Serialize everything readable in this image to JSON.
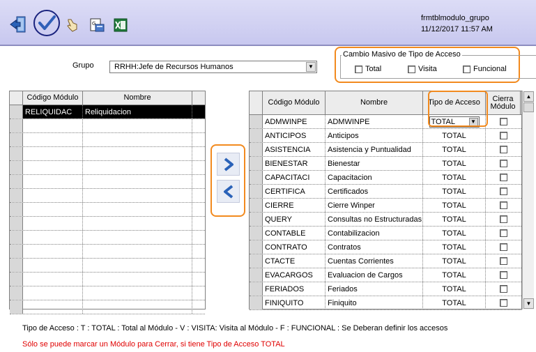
{
  "toolbar": {
    "window_name": "frmtblmodulo_grupo",
    "datetime": "11/12/2017 11:57 AM",
    "icons": [
      "exit-icon",
      "confirm-check-icon",
      "hand-pointer-icon",
      "report-icon",
      "excel-icon"
    ]
  },
  "grupo": {
    "label": "Grupo",
    "value": "RRHH:Jefe de Recursos Humanos"
  },
  "cambio_masivo": {
    "legend": "Cambio Masivo de Tipo de Acceso",
    "options": [
      "Total",
      "Visita",
      "Funcional"
    ]
  },
  "left_grid": {
    "headers": [
      "Código Módulo",
      "Nombre"
    ],
    "rows": [
      {
        "codigo": "RELIQUIDAC",
        "nombre": "Reliquidacion",
        "selected": true
      }
    ],
    "total_rows": 15
  },
  "right_grid": {
    "headers": [
      "Código Módulo",
      "Nombre",
      "Tipo de Acceso",
      "Cierra Módulo"
    ],
    "rows": [
      {
        "codigo": "ADMWINPE",
        "nombre": "ADMWINPE",
        "tipo": "TOTAL",
        "editing": true
      },
      {
        "codigo": "ANTICIPOS",
        "nombre": "Anticipos",
        "tipo": "TOTAL"
      },
      {
        "codigo": "ASISTENCIA",
        "nombre": "Asistencia y Puntualidad",
        "tipo": "TOTAL"
      },
      {
        "codigo": "BIENESTAR",
        "nombre": "Bienestar",
        "tipo": "TOTAL"
      },
      {
        "codigo": "CAPACITACI",
        "nombre": "Capacitacion",
        "tipo": "TOTAL"
      },
      {
        "codigo": "CERTIFICA",
        "nombre": "Certificados",
        "tipo": "TOTAL"
      },
      {
        "codigo": "CIERRE",
        "nombre": "Cierre Winper",
        "tipo": "TOTAL"
      },
      {
        "codigo": "QUERY",
        "nombre": "Consultas no Estructuradas",
        "tipo": "TOTAL"
      },
      {
        "codigo": "CONTABLE",
        "nombre": "Contabilizacion",
        "tipo": "TOTAL"
      },
      {
        "codigo": "CONTRATO",
        "nombre": "Contratos",
        "tipo": "TOTAL"
      },
      {
        "codigo": "CTACTE",
        "nombre": "Cuentas Corrientes",
        "tipo": "TOTAL"
      },
      {
        "codigo": "EVACARGOS",
        "nombre": "Evaluacion de Cargos",
        "tipo": "TOTAL"
      },
      {
        "codigo": "FERIADOS",
        "nombre": "Feriados",
        "tipo": "TOTAL"
      },
      {
        "codigo": "FINIQUITO",
        "nombre": "Finiquito",
        "tipo": "TOTAL"
      }
    ]
  },
  "footer": {
    "legend": "Tipo de Acceso : T : TOTAL : Total al Módulo  - V : VISITA: Visita al Módulo  - F : FUNCIONAL : Se Deberan definir los accesos",
    "warning": "Sólo se puede marcar un Módulo para Cerrar, si tiene Tipo de Acceso TOTAL"
  },
  "colors": {
    "toolbar": "#d4d4f4",
    "highlight": "#f28a1e",
    "warning": "#e00000",
    "arrow": "#2a62b8"
  }
}
